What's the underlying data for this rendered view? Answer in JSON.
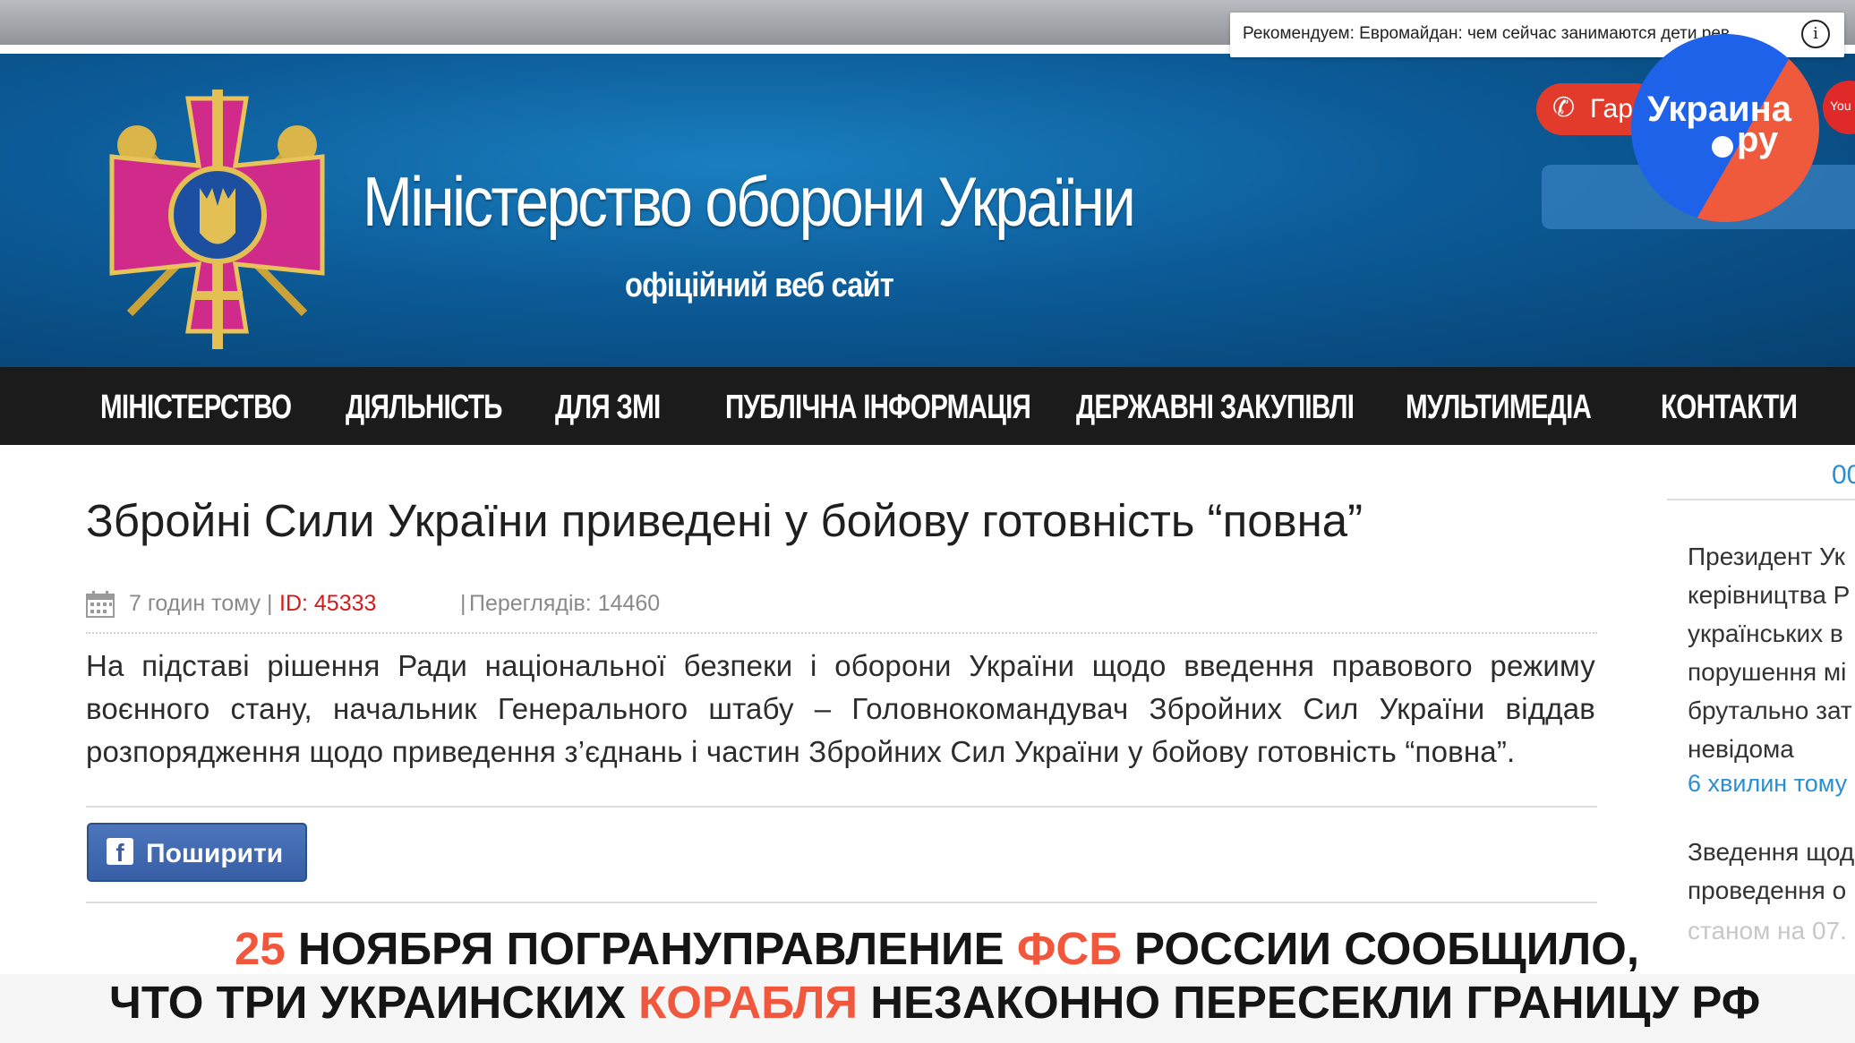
{
  "video_overlay": {
    "recommendation": "Рекомендуем: Евромайдан: чем сейчас занимаются дети рев...",
    "info_icon": "info-icon",
    "channel_logo": {
      "line1": "Украина",
      "line2": "ру"
    },
    "colors": {
      "logo_blue": "#1d62e8",
      "logo_red": "#ef5a3c",
      "caption_accent": "#f0573c"
    }
  },
  "header": {
    "title": "Міністерство оборони України",
    "subtitle": "офіційний веб сайт",
    "hotline_label": "Гаря",
    "youtube_label": "You"
  },
  "nav": {
    "items": [
      "МІНІСТЕРСТВО",
      "ДІЯЛЬНІСТЬ",
      "ДЛЯ ЗМІ",
      "ПУБЛІЧНА ІНФОРМАЦІЯ",
      "ДЕРЖАВНІ ЗАКУПІВЛІ",
      "МУЛЬТИМЕДІА",
      "КОНТАКТИ"
    ]
  },
  "article": {
    "title": "Збройні Сили України приведені у бойову готовність “повна”",
    "time": "7 годин тому",
    "id": "ID: 45333",
    "views": "Переглядів: 14460",
    "separator": "|",
    "body": "На підставі рішення Ради національної безпеки і оборони України щодо введення правового режиму воєнного стану, начальник Генерального штабу – Головнокомандувач Збройних Сил України віддав розпорядження щодо приведення з’єднань і частин Збройних Сил України у бойову готовність “повна”.",
    "share_label": "Поширити"
  },
  "sidebar": {
    "tab_label": "00",
    "news1": "Президент Ук керівництва Р українських в порушення мі брутально зат невідома",
    "news1_time": "6 хвилин тому",
    "news2": "Зведення щод проведення о",
    "news2_faded": "станом на 07."
  },
  "caption": {
    "line1": [
      {
        "text": "25",
        "accent": true
      },
      {
        "text": " НОЯБРЯ ПОГРАНУПРАВЛЕНИЕ ",
        "accent": false
      },
      {
        "text": "ФСБ",
        "accent": true
      },
      {
        "text": " РОССИИ СООБЩИЛО,",
        "accent": false
      }
    ],
    "line2": [
      {
        "text": "ЧТО ТРИ УКРАИНСКИХ ",
        "accent": false
      },
      {
        "text": "КОРАБЛЯ",
        "accent": true
      },
      {
        "text": " НЕЗАКОННО ПЕРЕСЕКЛИ ГРАНИЦУ РФ",
        "accent": false
      }
    ]
  }
}
